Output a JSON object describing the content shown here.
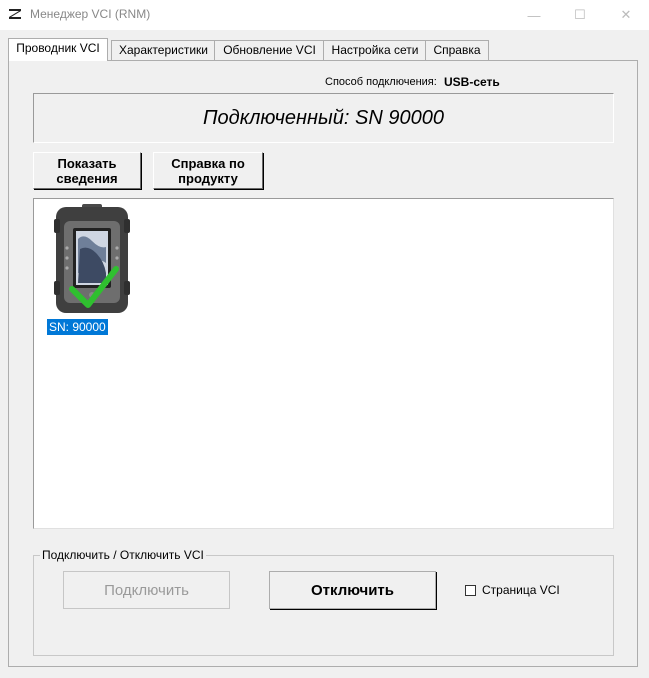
{
  "window": {
    "title": "Менеджер  VCI (RNM)",
    "minimize_glyph": "—",
    "maximize_glyph": "☐",
    "close_glyph": "✕"
  },
  "tabs": [
    {
      "label": "Проводник VCI",
      "active": true
    },
    {
      "label": "Характеристики",
      "active": false
    },
    {
      "label": "Обновление VCI",
      "active": false
    },
    {
      "label": "Настройка сети",
      "active": false
    },
    {
      "label": "Справка",
      "active": false
    }
  ],
  "connection": {
    "label": "Способ подключения:",
    "value": "USB-сеть"
  },
  "status": {
    "text": "Подключенный: SN 90000"
  },
  "buttons": {
    "show_info": "Показать сведения",
    "product_help": "Справка по продукту",
    "connect": "Подключить",
    "disconnect": "Отключить"
  },
  "devices": [
    {
      "label": "SN: 90000",
      "selected": true,
      "connected": true
    }
  ],
  "group": {
    "title": "Подключить / Отключить VCI",
    "checkbox_label": "Страница VCI",
    "checkbox_checked": false
  },
  "colors": {
    "selection": "#0078d7",
    "checkmark": "#2fc02f",
    "device_body": "#5a5a5a"
  }
}
